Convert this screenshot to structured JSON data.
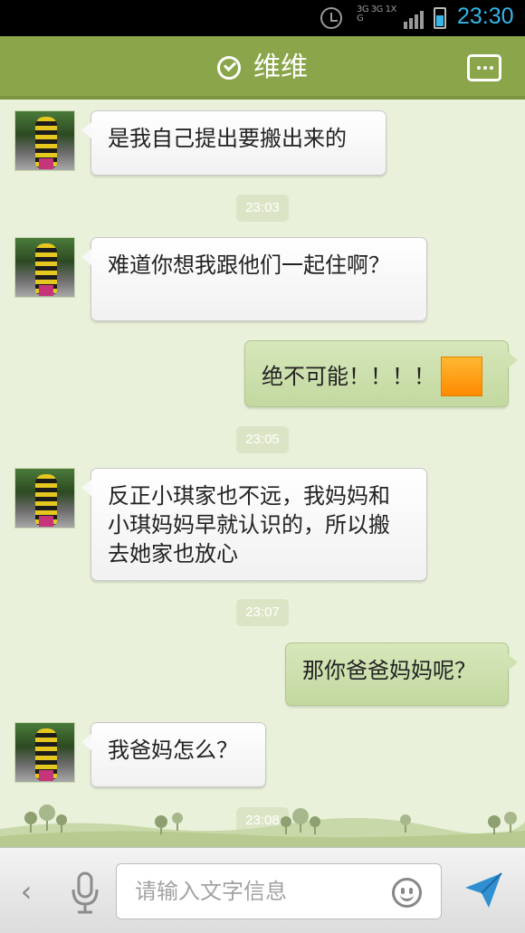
{
  "status_bar": {
    "network": "3G 3G 1X G",
    "time": "23:30"
  },
  "header": {
    "contact_name": "维维",
    "verified_icon": "check-circle-icon",
    "menu_icon": "more-menu-icon"
  },
  "messages": [
    {
      "side": "left",
      "text": "是我自己提出要搬出来的"
    },
    {
      "timestamp": "23:03"
    },
    {
      "side": "left",
      "text": "难道你想我跟他们一起住啊？"
    },
    {
      "side": "right",
      "text": "绝不可能！！！！",
      "emoji": "orange-square-emoji"
    },
    {
      "timestamp": "23:05"
    },
    {
      "side": "left",
      "text": "反正小琪家也不远，我妈妈和小琪妈妈早就认识的，所以搬去她家也放心"
    },
    {
      "timestamp": "23:07"
    },
    {
      "side": "right",
      "text": "那你爸爸妈妈呢？"
    },
    {
      "side": "left",
      "text": "我爸妈怎么？"
    },
    {
      "timestamp": "23:08"
    }
  ],
  "input_bar": {
    "placeholder": "请输入文字信息",
    "back_icon": "chevron-left-icon",
    "mic_icon": "microphone-icon",
    "emoji_icon": "smiley-icon",
    "send_icon": "send-icon"
  },
  "colors": {
    "header_bg": "#8aa54a",
    "chat_bg": "#e9f1da",
    "sent_bubble": "#cfe1b0",
    "time_accent": "#35b6e8"
  }
}
